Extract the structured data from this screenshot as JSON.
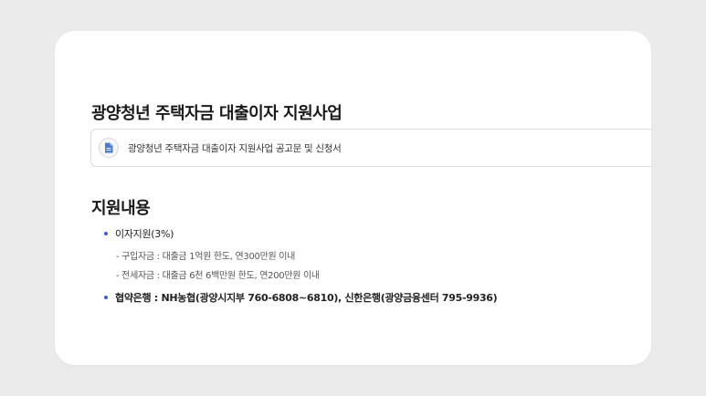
{
  "page": {
    "title": "광양청년 주택자금 대출이자 지원사업"
  },
  "attachment": {
    "icon": "document-icon",
    "label": "광양청년 주택자금 대출이자 지원사업 공고문 및 신청서"
  },
  "support": {
    "title": "지원내용",
    "items": [
      {
        "label": "이자지원(3%)",
        "subitems": [
          "- 구입자금 : 대출금 1억원 한도, 연300만원 이내",
          "- 전세자금 : 대출금 6천 6백만원 한도, 연200만원 이내"
        ]
      },
      {
        "label": "협약은행 : NH농협(광양시지부 760-6808~6810), 신한은행(광양금융센터 795-9936)"
      }
    ]
  },
  "colors": {
    "background": "#ebebeb",
    "card": "#ffffff",
    "bullet": "#3b5bdb",
    "icon": "#4a7bd0"
  }
}
